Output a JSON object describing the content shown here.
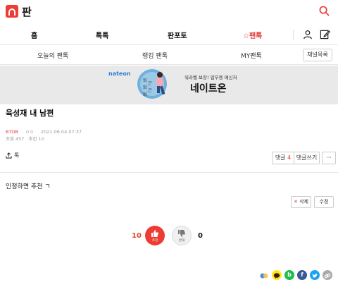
{
  "header": {
    "title": "판"
  },
  "main_nav": {
    "items": [
      "홈",
      "톡톡",
      "판포토",
      "☆팬톡"
    ]
  },
  "sub_nav": {
    "items": [
      "오늘의 팬톡",
      "랭킹 팬톡",
      "MY팬톡"
    ],
    "channel_button": "채널목록"
  },
  "banner": {
    "brand": "nateon",
    "subtitle": "워라벨 보장! 업무용 메신저",
    "title": "네이트온",
    "art_text": [
      "퇴",
      "근",
      "퇴",
      "근",
      "퇴"
    ]
  },
  "post": {
    "title": "육성재 내 남편",
    "author": "BTOB",
    "nickname": "ㅇㅇ",
    "date": "2021.06.04 07:37",
    "views": "조회 457",
    "recommend": "추천 10",
    "share_label": "톡",
    "comments_label": "댓글",
    "comments_count": "4",
    "write_comment_label": "댓글쓰기",
    "more_label": "···",
    "body": "인정하면 추천 ㄱ",
    "delete_label": "삭제",
    "edit_label": "수정",
    "recommend_count": "10",
    "recommend_label": "추천",
    "oppose_label": "반대",
    "oppose_count": "0"
  },
  "colors": {
    "brand_red": "#ee3b34",
    "accent_red": "#e23b3b",
    "facebook": "#3b5998",
    "twitter": "#1da1f2",
    "kakao": "#ffe812"
  },
  "icons": [
    "search-icon",
    "user-icon",
    "write-icon",
    "share-icon",
    "thumbs-up-icon",
    "thumbs-down-icon",
    "nateon-icon",
    "kakao-icon",
    "band-icon",
    "facebook-icon",
    "twitter-icon",
    "link-icon"
  ]
}
